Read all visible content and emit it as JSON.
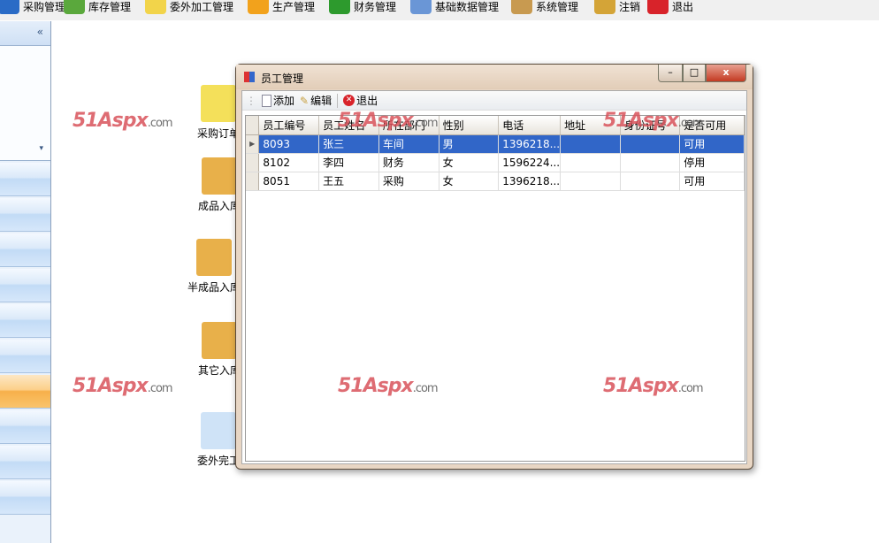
{
  "menu": [
    {
      "label": "采购管理",
      "icon": "purchase-icon",
      "color": "#2a6bc6"
    },
    {
      "label": "库存管理",
      "icon": "warehouse-icon",
      "color": "#5aa83c"
    },
    {
      "label": "委外加工管理",
      "icon": "folder-icon",
      "color": "#f2d44a"
    },
    {
      "label": "生产管理",
      "icon": "gear-icon",
      "color": "#f2a21c"
    },
    {
      "label": "财务管理",
      "icon": "dollar-icon",
      "color": "#2d9a2d"
    },
    {
      "label": "基础数据管理",
      "icon": "table-icon",
      "color": "#6a96d6"
    },
    {
      "label": "系统管理",
      "icon": "tools-icon",
      "color": "#c89a50"
    },
    {
      "label": "注销",
      "icon": "key-icon",
      "color": "#d4a437"
    },
    {
      "label": "退出",
      "icon": "exit-icon",
      "color": "#d8232a"
    }
  ],
  "sidebar": {
    "collapse": "«",
    "dropdown": "▾"
  },
  "desktop": [
    {
      "label": "采购订单",
      "icon": "clipboard-icon"
    },
    {
      "label": "成品入库",
      "icon": "boxes-icon"
    },
    {
      "label": "半成品入库",
      "icon": "boxes-icon"
    },
    {
      "label": "其它入库",
      "icon": "boxes-icon"
    },
    {
      "label": "委外完工",
      "icon": "check-icon"
    }
  ],
  "watermark": {
    "brand": "51Aspx",
    ".com": ".com"
  },
  "window": {
    "title": "员工管理",
    "minimize": "–",
    "maximize": "□",
    "close": "x",
    "toolbar": {
      "add": "添加",
      "edit": "编辑",
      "exit": "退出"
    },
    "columns": [
      "员工编号",
      "员工姓名",
      "所在部门",
      "性别",
      "电话",
      "地址",
      "身份证号",
      "是否可用"
    ],
    "rows": [
      [
        "8093",
        "张三",
        "车间",
        "男",
        "1396218...",
        "",
        "",
        "可用"
      ],
      [
        "8102",
        "李四",
        "财务",
        "女",
        "1596224...",
        "",
        "",
        "停用"
      ],
      [
        "8051",
        "王五",
        "采购",
        "女",
        "1396218...",
        "",
        "",
        "可用"
      ]
    ],
    "selected_row": 0
  }
}
